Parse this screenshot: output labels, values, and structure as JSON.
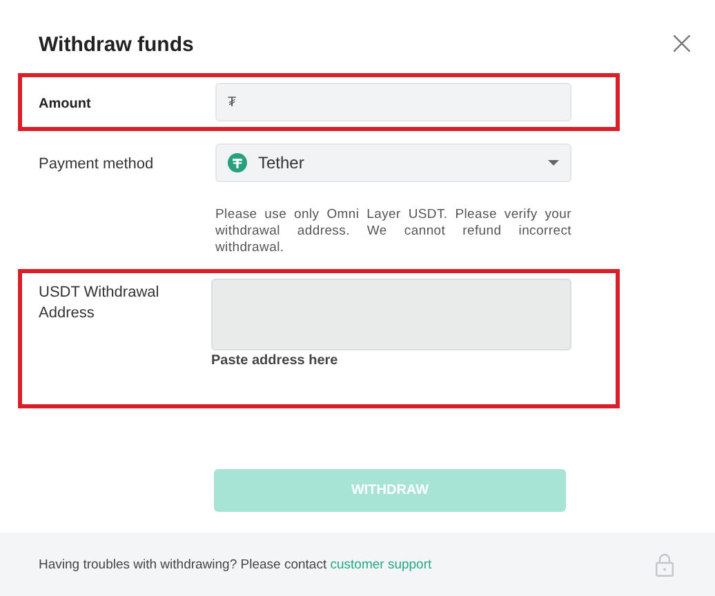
{
  "dialog": {
    "title": "Withdraw funds",
    "close_icon": "×"
  },
  "rows": [
    {
      "kind": "input",
      "label": "Amount",
      "prefix": "₮",
      "highlighted": true
    },
    {
      "kind": "select",
      "label": "Payment method",
      "value": "Tether",
      "highlighted": false
    },
    {
      "kind": "note",
      "text": "Please use only Omni Layer USDT. Please verify your withdrawal address. We cannot refund incorrect withdrawal.",
      "highlighted": false
    },
    {
      "kind": "textarea",
      "label": "USDT Withdrawal Address",
      "hint": "Paste address here",
      "highlighted": true
    }
  ],
  "button": {
    "label": "WITHDRAW",
    "disabled": true
  },
  "footer": {
    "text": "Having troubles with withdrawing? Please contact",
    "link": "customer support"
  }
}
